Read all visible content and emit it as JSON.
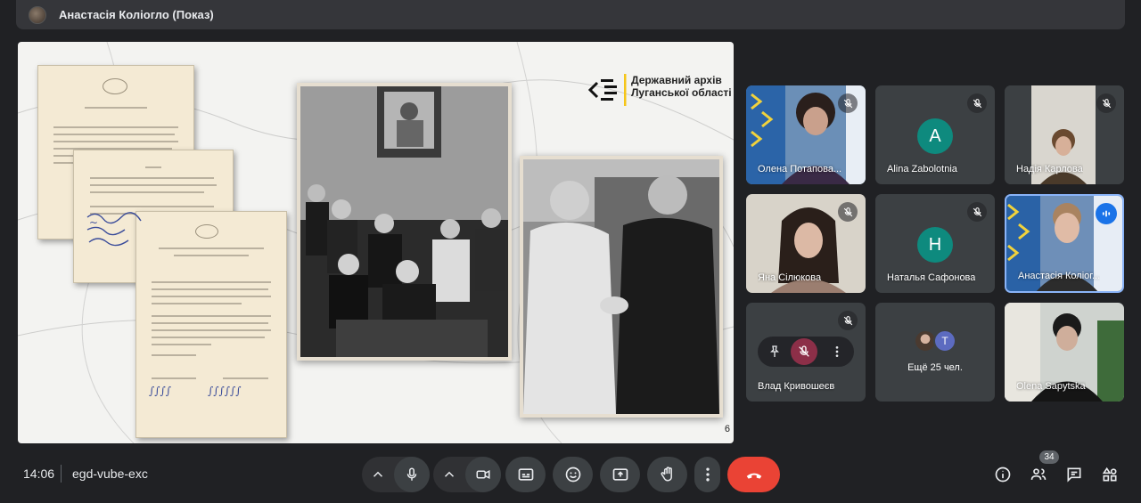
{
  "presenter": {
    "title": "Анастасія Коліогло (Показ)"
  },
  "slide": {
    "archive_line1": "Державний архів",
    "archive_line2": "Луганської області",
    "page_number": "6"
  },
  "participants": [
    {
      "name": "Олена Потапова...",
      "muted": true
    },
    {
      "name": "Alina Zabolotnia",
      "avatar_letter": "A",
      "muted": true
    },
    {
      "name": "Надія Карлова",
      "muted": true
    },
    {
      "name": "Яна Сілюкова",
      "muted": true
    },
    {
      "name": "Наталья Сафонова",
      "avatar_letter": "H",
      "muted": true
    },
    {
      "name": "Анастасія Коліог...",
      "speaking": true
    },
    {
      "name": "Влад Кривошеєв",
      "muted": true
    },
    {
      "name": "Ещё 25 чел.",
      "mini_letter": "T"
    },
    {
      "name": "Olena Sapytska"
    }
  ],
  "bottom_bar": {
    "time": "14:06",
    "meeting_code": "egd-vube-exc",
    "people_count": "34"
  },
  "icons": {
    "mic": "mic-icon",
    "camera": "camera-icon",
    "captions": "captions-icon",
    "emoji": "emoji-icon",
    "present": "present-icon",
    "hand": "raise-hand-icon",
    "more": "more-options-icon",
    "hangup": "hangup-icon",
    "info": "info-icon",
    "people": "people-icon",
    "chat": "chat-icon",
    "activities": "activities-icon"
  },
  "colors": {
    "background": "#202124",
    "tile": "#3c4043",
    "hangup": "#ea4335",
    "speaking": "#1a73e8",
    "avatar": "#0e8a7e"
  }
}
